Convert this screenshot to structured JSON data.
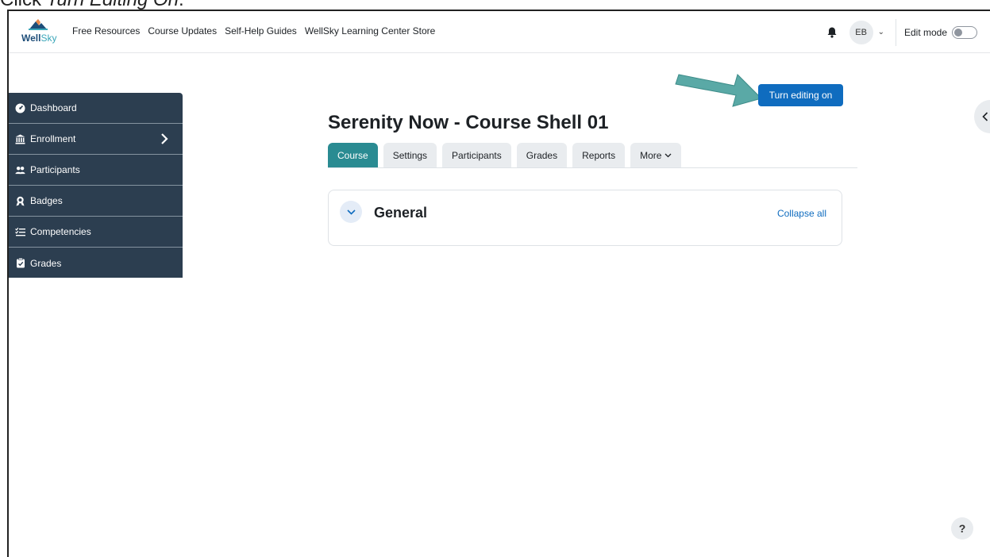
{
  "instruction": {
    "prefix": "Click ",
    "emphasis": "Turn Editing On",
    "suffix": "."
  },
  "brand": {
    "logo_text_bold": "Well",
    "logo_text_light": "Sky",
    "logo_icon": "mountain-logo-icon",
    "colors": {
      "dark": "#1e4e79",
      "light": "#3aa6b9"
    }
  },
  "navbar": {
    "links": [
      "Free Resources",
      "Course Updates",
      "Self-Help Guides",
      "WellSky Learning Center Store"
    ],
    "avatar_initials": "EB",
    "edit_mode_label": "Edit mode",
    "edit_mode_on": false,
    "icons": {
      "notifications": "bell-icon",
      "user_menu": "chevron-down-icon"
    }
  },
  "sidebar": {
    "background": "#2c3e50",
    "items": [
      {
        "label": "Dashboard",
        "icon": "dashboard-icon"
      },
      {
        "label": "Enrollment",
        "icon": "institution-icon",
        "has_submenu": true
      },
      {
        "label": "Participants",
        "icon": "users-icon"
      },
      {
        "label": "Badges",
        "icon": "badge-icon"
      },
      {
        "label": "Competencies",
        "icon": "checklist-icon"
      },
      {
        "label": "Grades",
        "icon": "clipboard-icon"
      }
    ]
  },
  "main": {
    "turn_editing_label": "Turn editing on",
    "course_title": "Serenity Now - Course Shell 01",
    "tabs": [
      {
        "label": "Course",
        "active": true
      },
      {
        "label": "Settings",
        "active": false
      },
      {
        "label": "Participants",
        "active": false
      },
      {
        "label": "Grades",
        "active": false
      },
      {
        "label": "Reports",
        "active": false
      },
      {
        "label": "More",
        "active": false,
        "dropdown": true
      }
    ],
    "section": {
      "title": "General",
      "collapse_all_label": "Collapse all",
      "expanded": true
    },
    "accent_color": "#0f6cbf",
    "active_tab_color": "#2a8b92"
  },
  "help": {
    "label": "?"
  }
}
